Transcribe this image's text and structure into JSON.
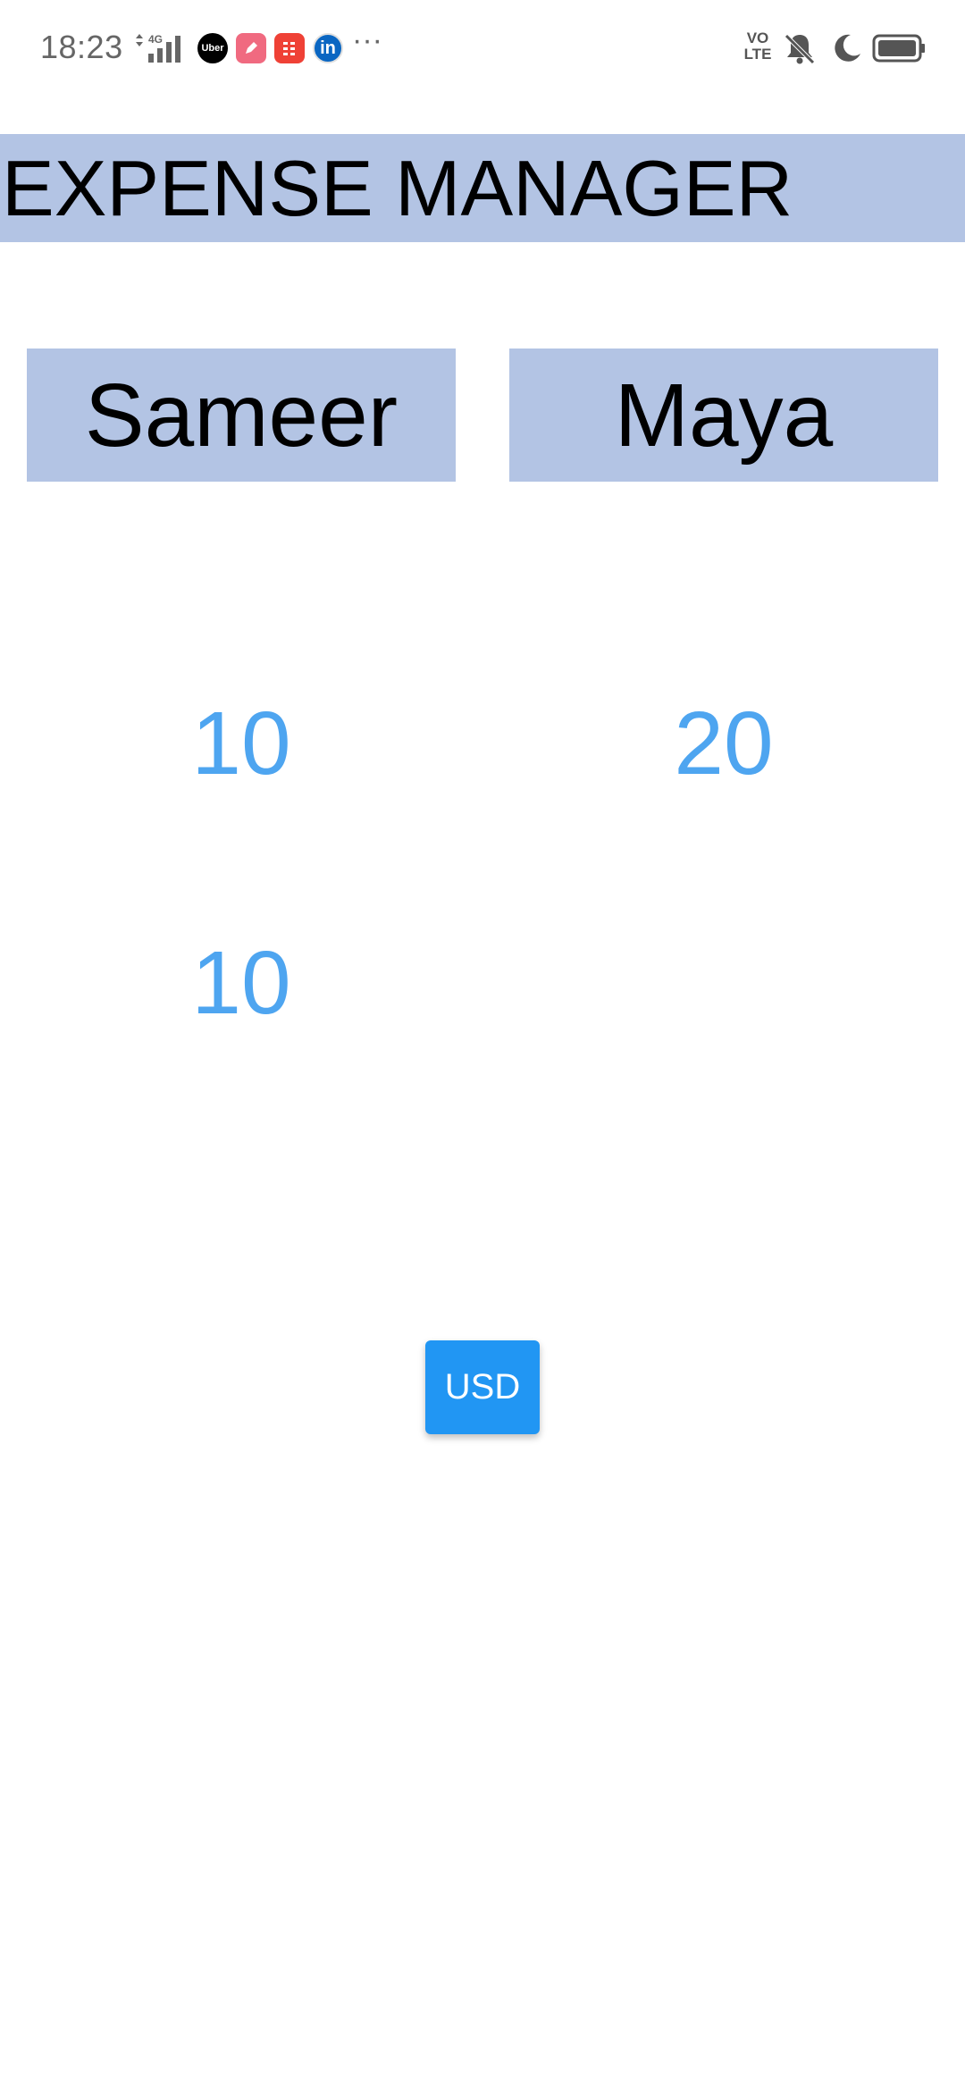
{
  "status_bar": {
    "time": "18:23",
    "network": "4G",
    "apps": [
      {
        "name": "uber-icon",
        "label": "Uber"
      },
      {
        "name": "pen-app-icon",
        "label": ""
      },
      {
        "name": "calculator-app-icon",
        "label": ""
      },
      {
        "name": "linkedin-icon",
        "label": "in"
      }
    ],
    "more": "···",
    "volte": {
      "line1": "VO",
      "line2": "LTE"
    },
    "icons": [
      "signal-icon",
      "mute-icon",
      "moon-icon",
      "battery-icon"
    ]
  },
  "header": {
    "title": "EXPENSE MANAGER"
  },
  "people": [
    {
      "name": "Sameer",
      "expenses": [
        "10",
        "10"
      ]
    },
    {
      "name": "Maya",
      "expenses": [
        "20"
      ]
    }
  ],
  "currency_button": {
    "label": "USD"
  },
  "colors": {
    "header_bg": "#b3c4e4",
    "expense_text": "#4ea5f0",
    "button_bg": "#2196f3"
  }
}
